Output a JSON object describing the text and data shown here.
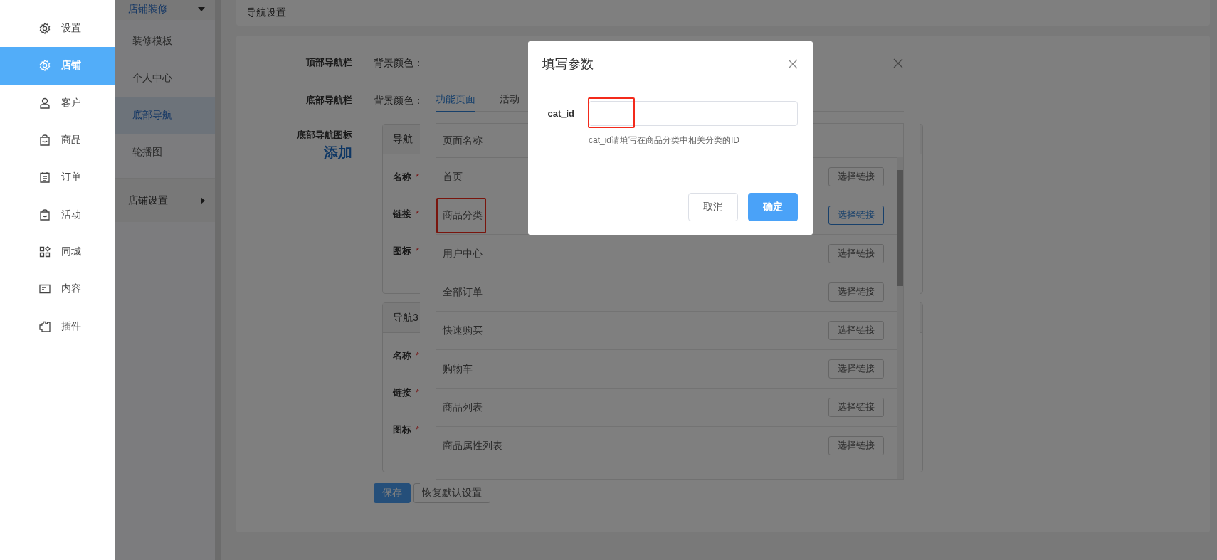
{
  "sidebar": {
    "items": [
      {
        "label": "设置",
        "selected": false
      },
      {
        "label": "店铺",
        "selected": true
      },
      {
        "label": "客户",
        "selected": false
      },
      {
        "label": "商品",
        "selected": false
      },
      {
        "label": "订单",
        "selected": false
      },
      {
        "label": "活动",
        "selected": false
      },
      {
        "label": "同城",
        "selected": false
      },
      {
        "label": "内容",
        "selected": false
      },
      {
        "label": "插件",
        "selected": false
      }
    ]
  },
  "submenu": {
    "groups": [
      {
        "label": "店铺装修",
        "expanded": true,
        "items": [
          {
            "label": "装修模板",
            "selected": false
          },
          {
            "label": "个人中心",
            "selected": false
          },
          {
            "label": "底部导航",
            "selected": true
          },
          {
            "label": "轮播图",
            "selected": false
          }
        ]
      },
      {
        "label": "店铺设置",
        "expanded": false
      }
    ]
  },
  "page_header": {
    "title": "导航设置"
  },
  "form": {
    "rows": [
      {
        "label": "顶部导航栏",
        "value": "背景颜色："
      },
      {
        "label": "底部导航栏",
        "value": "背景颜色："
      }
    ],
    "icons_label": "底部导航图标",
    "add_link": "添加",
    "nav_cards": [
      {
        "title": "导航",
        "fields": [
          {
            "label": "名称",
            "required_mark": "*"
          },
          {
            "label": "链接",
            "required_mark": "*"
          },
          {
            "label": "图标",
            "required_mark": "*"
          }
        ]
      },
      {
        "title": "导航3",
        "fields": [
          {
            "label": "名称",
            "required_mark": "*"
          },
          {
            "label": "链接",
            "required_mark": "*"
          },
          {
            "label": "图标",
            "required_mark": "*"
          }
        ]
      }
    ],
    "buttons": [
      {
        "label": "保存",
        "kind": "primary"
      },
      {
        "label": "恢复默认设置",
        "kind": "default"
      }
    ]
  },
  "link_dialog": {
    "tabs": [
      {
        "label": "功能页面",
        "selected": true
      },
      {
        "label": "活动",
        "selected": false
      }
    ],
    "column": "页面名称",
    "rows": [
      {
        "name": "首页",
        "button": "选择链接",
        "marked": false,
        "button_active": false
      },
      {
        "name": "商品分类",
        "button": "选择链接",
        "marked": true,
        "button_active": true
      },
      {
        "name": "用户中心",
        "button": "选择链接",
        "marked": false,
        "button_active": false
      },
      {
        "name": "全部订单",
        "button": "选择链接",
        "marked": false,
        "button_active": false
      },
      {
        "name": "快速购买",
        "button": "选择链接",
        "marked": false,
        "button_active": false
      },
      {
        "name": "购物车",
        "button": "选择链接",
        "marked": false,
        "button_active": false
      },
      {
        "name": "商品列表",
        "button": "选择链接",
        "marked": false,
        "button_active": false
      },
      {
        "name": "商品属性列表",
        "button": "选择链接",
        "marked": false,
        "button_active": false
      }
    ]
  },
  "param_dialog": {
    "title": "填写参数",
    "field": {
      "label": "cat_id",
      "hint": "cat_id请填写在商品分类中相关分类的ID",
      "marked": true
    },
    "buttons": [
      {
        "label": "取消",
        "kind": "default"
      },
      {
        "label": "确定",
        "kind": "primary"
      }
    ]
  }
}
